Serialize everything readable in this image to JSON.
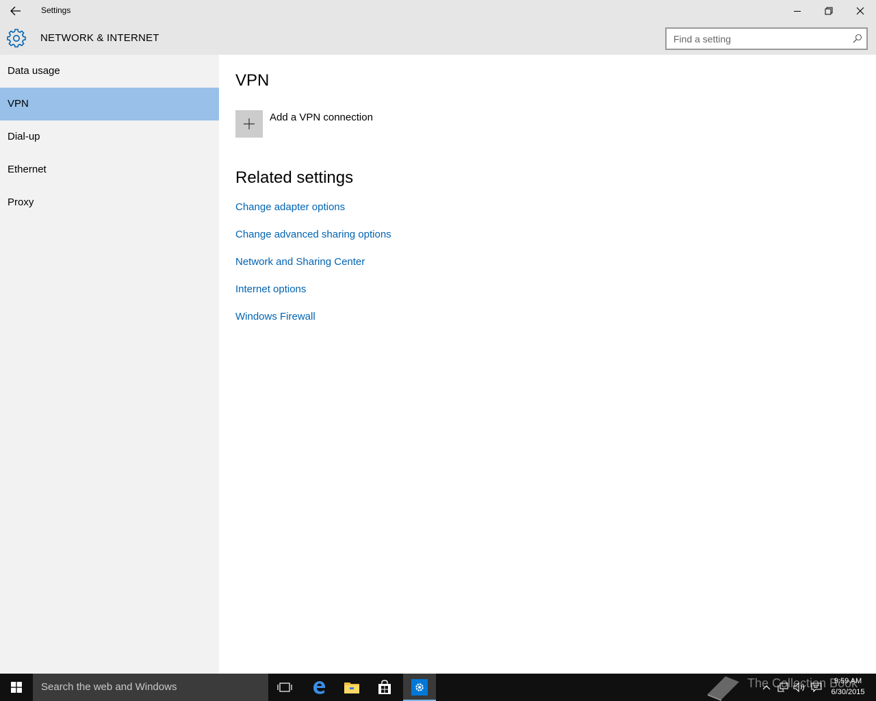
{
  "window": {
    "title": "Settings"
  },
  "header": {
    "title": "NETWORK & INTERNET",
    "search_placeholder": "Find a setting"
  },
  "sidebar": {
    "items": [
      {
        "label": "Data usage"
      },
      {
        "label": "VPN",
        "active": true
      },
      {
        "label": "Dial-up"
      },
      {
        "label": "Ethernet"
      },
      {
        "label": "Proxy"
      }
    ]
  },
  "main": {
    "title": "VPN",
    "add_vpn_label": "Add a VPN connection",
    "related_title": "Related settings",
    "related_links": [
      "Change adapter options",
      "Change advanced sharing options",
      "Network and Sharing Center",
      "Internet options",
      "Windows Firewall"
    ]
  },
  "taskbar": {
    "search_text": "Search the web and Windows",
    "time": "9:59 AM",
    "date": "6/30/2015",
    "watermark": "The Collection Book"
  },
  "colors": {
    "accent": "#0063b1",
    "selection": "#98c0e8",
    "chrome": "#e6e6e6",
    "sidebar": "#f2f2f2",
    "taskbar": "#101010"
  }
}
